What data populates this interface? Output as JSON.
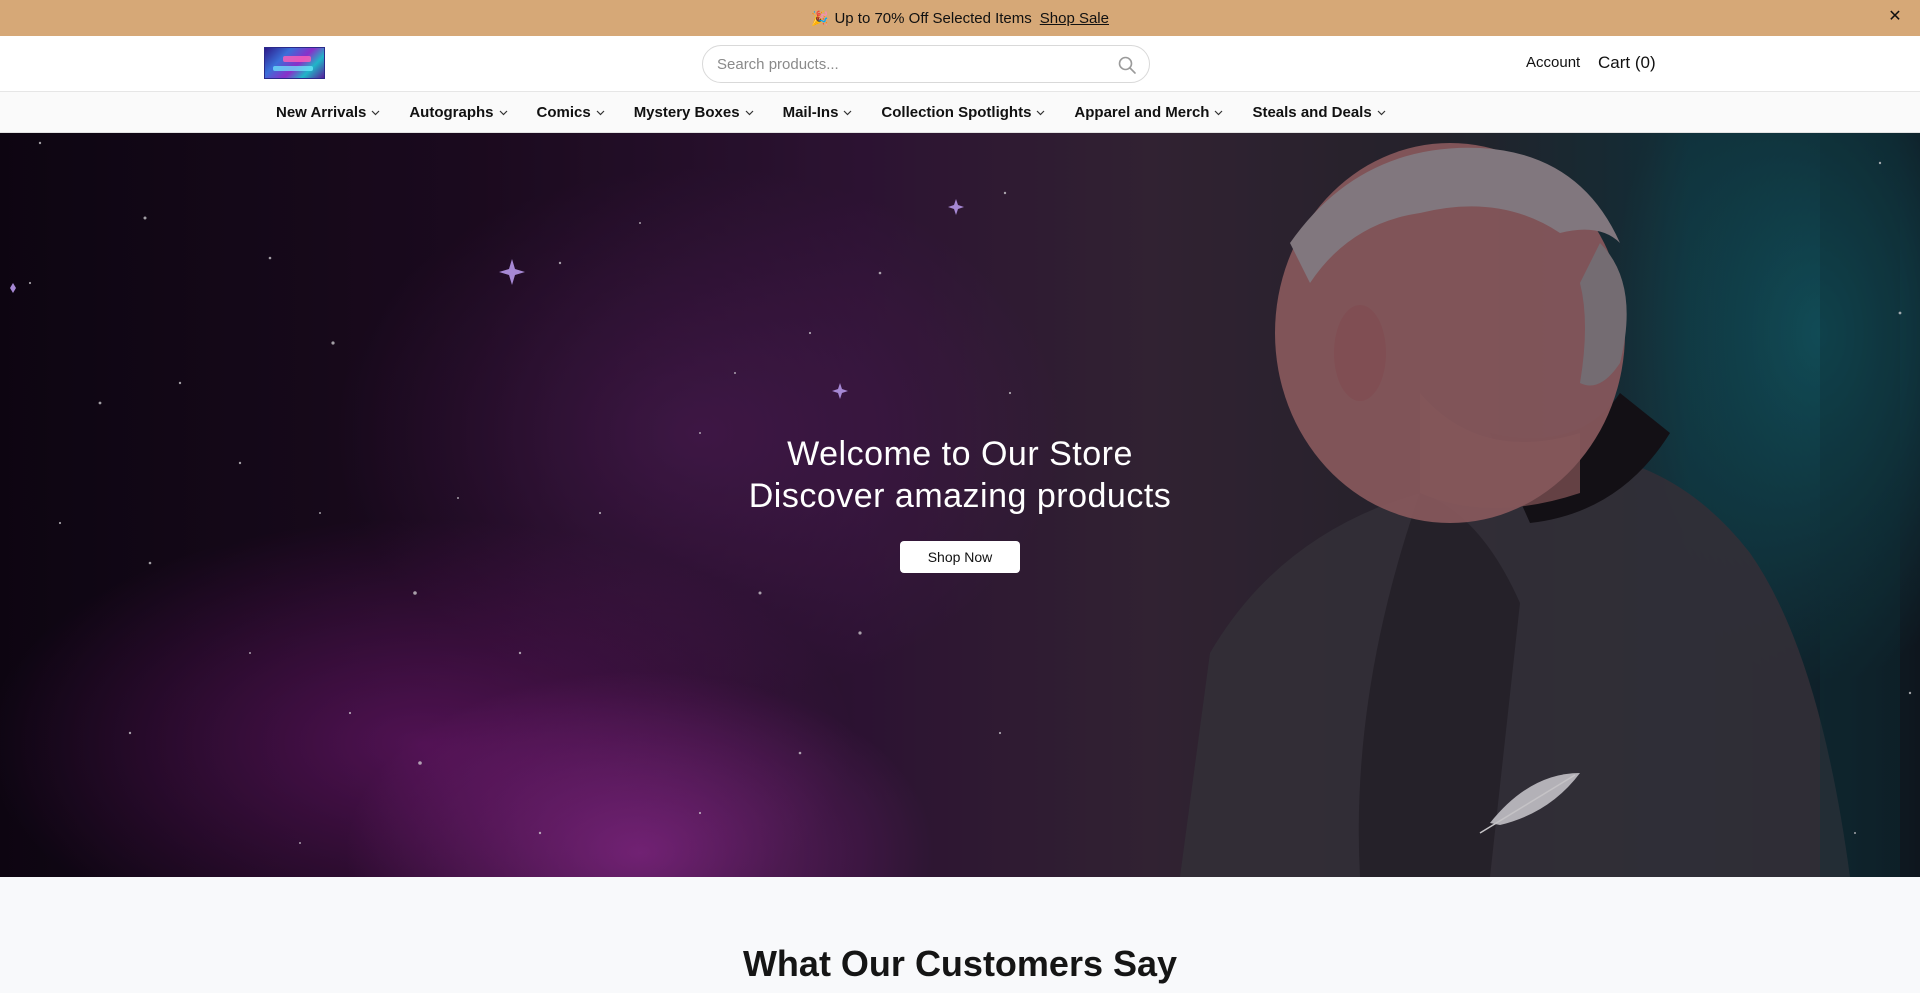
{
  "announcement": {
    "emoji": "🎉",
    "text": "Up to 70% Off Selected Items",
    "link_label": "Shop Sale",
    "close_glyph": "✕",
    "bg_color": "#D6A877"
  },
  "header": {
    "logo_icon": "store-logo",
    "search": {
      "placeholder": "Search products...",
      "icon": "search-icon"
    },
    "account_label": "Account",
    "cart_label": "Cart (0)"
  },
  "nav": {
    "items": [
      {
        "label": "New Arrivals"
      },
      {
        "label": "Autographs"
      },
      {
        "label": "Comics"
      },
      {
        "label": "Mystery Boxes"
      },
      {
        "label": "Mail-Ins"
      },
      {
        "label": "Collection Spotlights"
      },
      {
        "label": "Apparel and Merch"
      },
      {
        "label": "Steals and Deals"
      }
    ],
    "chevron_icon": "chevron-down-icon"
  },
  "hero": {
    "line1": "Welcome to Our Store",
    "line2": "Discover amazing products",
    "button_label": "Shop Now"
  },
  "testimonials": {
    "heading": "What Our Customers Say"
  }
}
